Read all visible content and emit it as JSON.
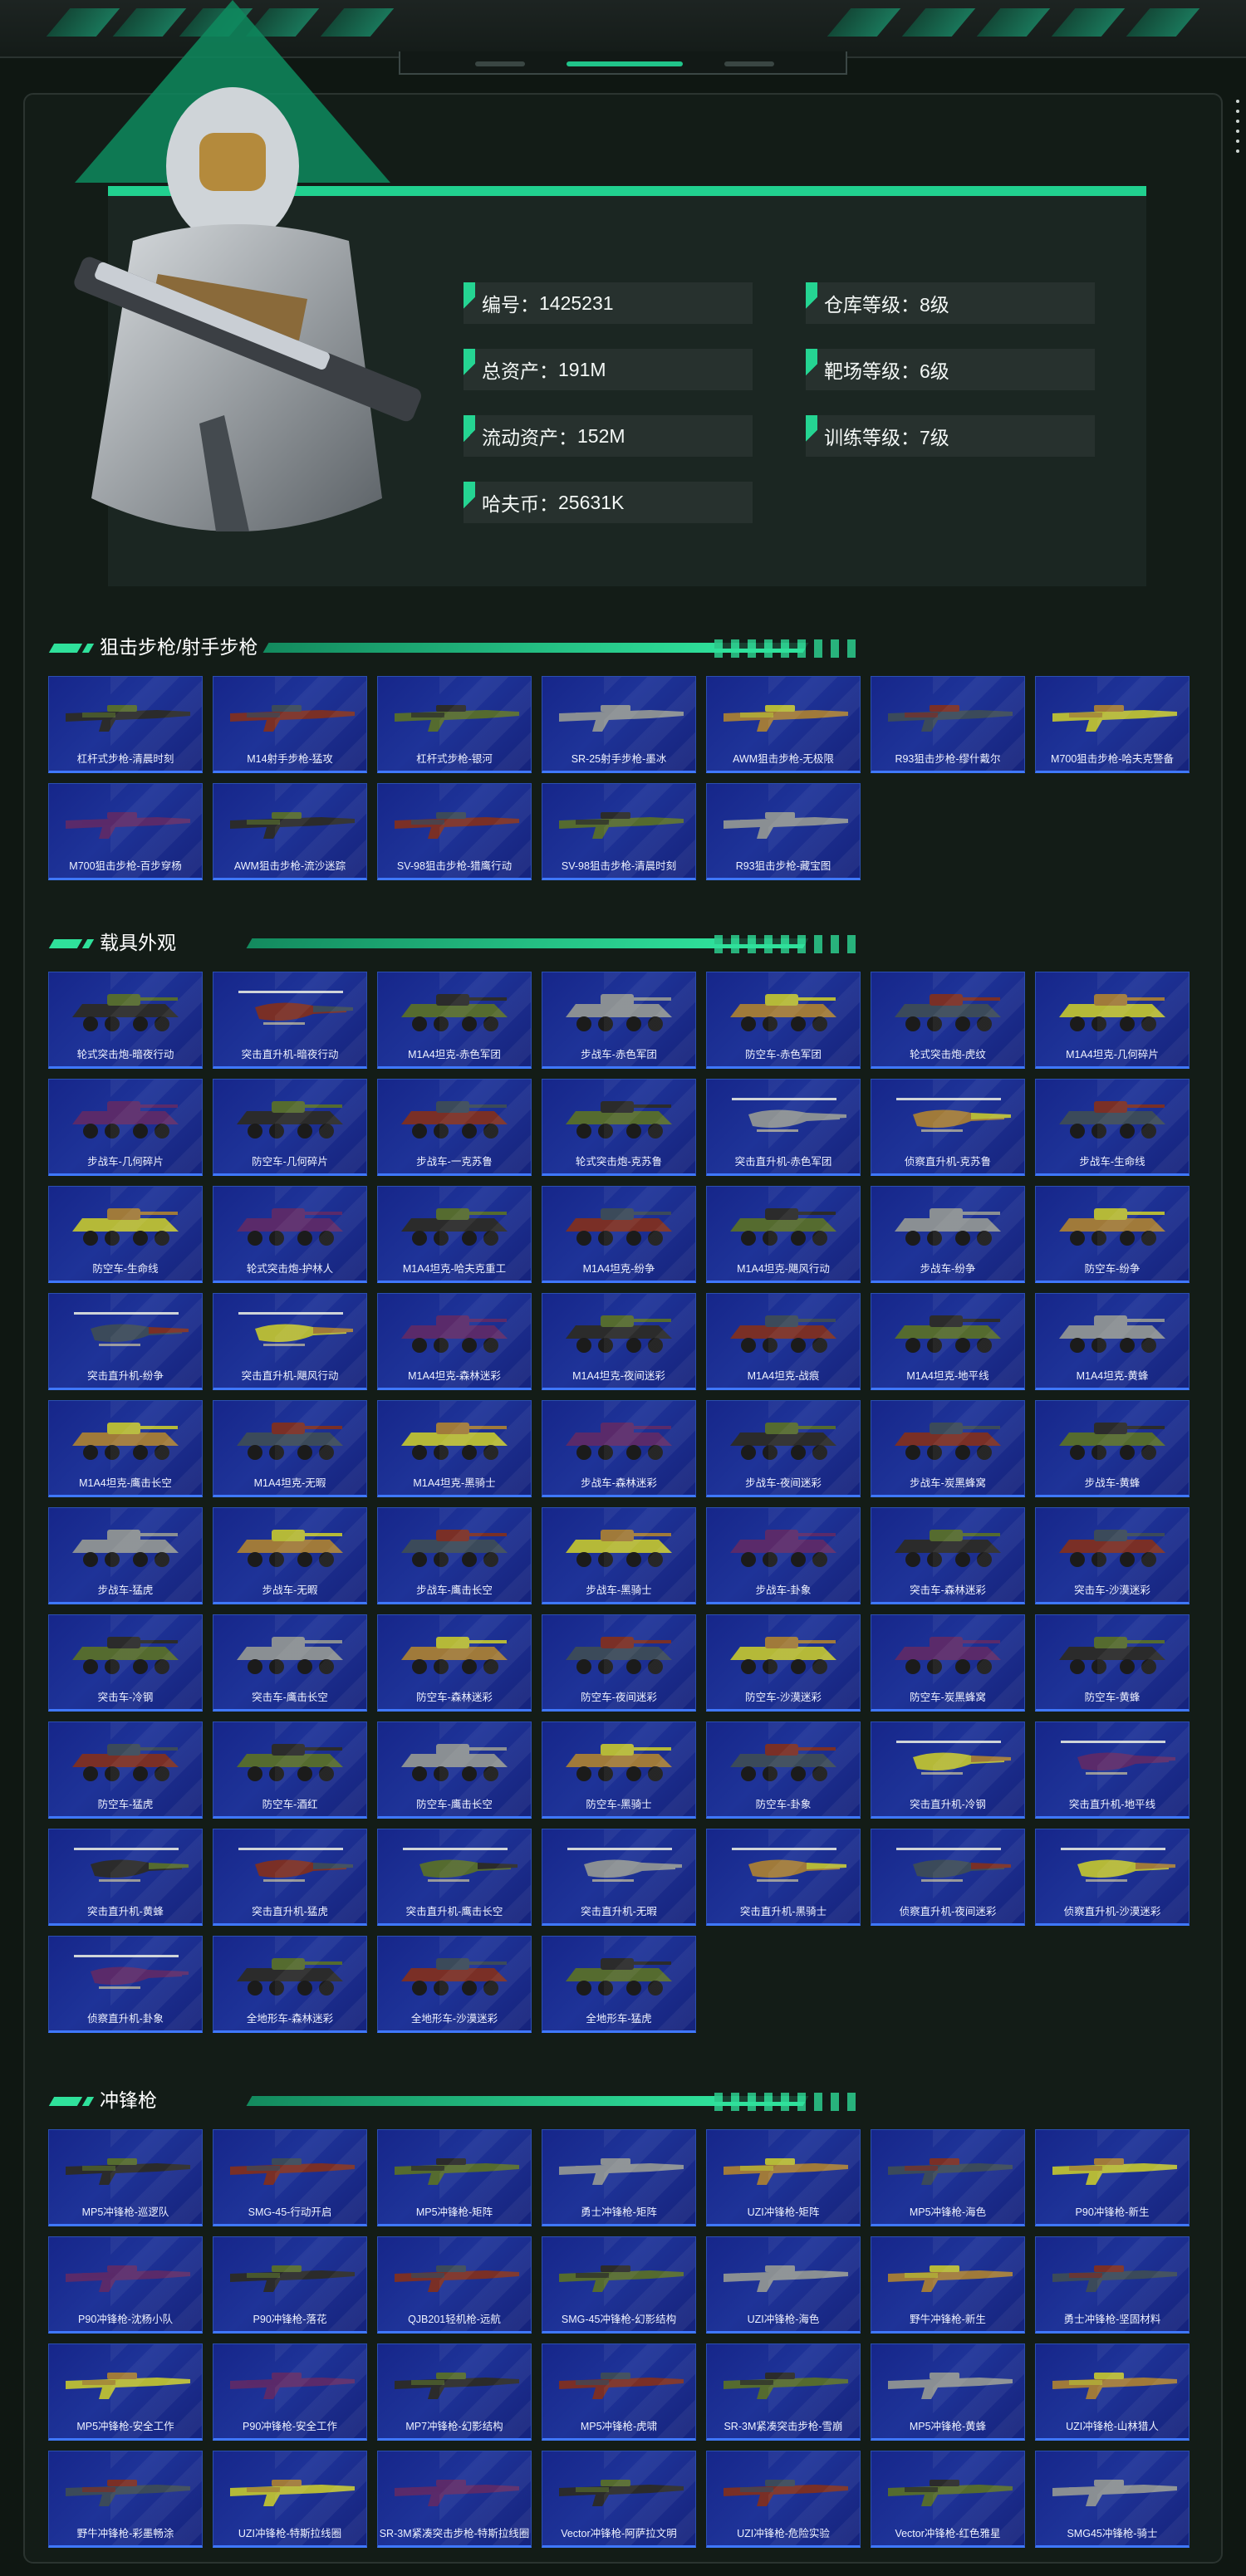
{
  "profile": {
    "stats": [
      {
        "label": "编号：",
        "value": "1425231"
      },
      {
        "label": "仓库等级：",
        "value": "8级"
      },
      {
        "label": "总资产：",
        "value": "191M"
      },
      {
        "label": "靶场等级：",
        "value": "6级"
      },
      {
        "label": "流动资产：",
        "value": "152M"
      },
      {
        "label": "训练等级：",
        "value": "7级"
      },
      {
        "label": "哈夫币：",
        "value": "25631K"
      }
    ]
  },
  "sections": [
    {
      "title": "狙击步枪/射手步枪",
      "kind": "gun",
      "items": [
        "杠杆式步枪-清晨时刻",
        "M14射手步枪-猛攻",
        "杠杆式步枪-银河",
        "SR-25射手步枪-墨冰",
        "AWM狙击步枪-无极限",
        "R93狙击步枪-缪什戴尔",
        "M700狙击步枪-哈夫克警备",
        "M700狙击步枪-百步穿杨",
        "AWM狙击步枪-流沙迷踪",
        "SV-98狙击步枪-猎鹰行动",
        "SV-98狙击步枪-清晨时刻",
        "R93狙击步枪-藏宝图"
      ]
    },
    {
      "title": "载具外观",
      "kind": "vehicle",
      "items": [
        "轮式突击炮-暗夜行动",
        "突击直升机-暗夜行动",
        "M1A4坦克-赤色军团",
        "步战车-赤色军团",
        "防空车-赤色军团",
        "轮式突击炮-虎纹",
        "M1A4坦克-几何碎片",
        "步战车-几何碎片",
        "防空车-几何碎片",
        "步战车-一克苏鲁",
        "轮式突击炮-克苏鲁",
        "突击直升机-赤色军团",
        "侦察直升机-克苏鲁",
        "步战车-生命线",
        "防空车-生命线",
        "轮式突击炮-护林人",
        "M1A4坦克-哈夫克重工",
        "M1A4坦克-纷争",
        "M1A4坦克-飓风行动",
        "步战车-纷争",
        "防空车-纷争",
        "突击直升机-纷争",
        "突击直升机-飓风行动",
        "M1A4坦克-森林迷彩",
        "M1A4坦克-夜间迷彩",
        "M1A4坦克-战痕",
        "M1A4坦克-地平线",
        "M1A4坦克-黄蜂",
        "M1A4坦克-鹰击长空",
        "M1A4坦克-无暇",
        "M1A4坦克-黑骑士",
        "步战车-森林迷彩",
        "步战车-夜间迷彩",
        "步战车-炭黑蜂窝",
        "步战车-黄蜂",
        "步战车-猛虎",
        "步战车-无暇",
        "步战车-鹰击长空",
        "步战车-黑骑士",
        "步战车-卦象",
        "突击车-森林迷彩",
        "突击车-沙漠迷彩",
        "突击车-冷钢",
        "突击车-鹰击长空",
        "防空车-森林迷彩",
        "防空车-夜间迷彩",
        "防空车-沙漠迷彩",
        "防空车-炭黑蜂窝",
        "防空车-黄蜂",
        "防空车-猛虎",
        "防空车-酒红",
        "防空车-鹰击长空",
        "防空车-黑骑士",
        "防空车-卦象",
        "突击直升机-冷钢",
        "突击直升机-地平线",
        "突击直升机-黄蜂",
        "突击直升机-猛虎",
        "突击直升机-鹰击长空",
        "突击直升机-无暇",
        "突击直升机-黑骑士",
        "侦察直升机-夜间迷彩",
        "侦察直升机-沙漠迷彩",
        "侦察直升机-卦象",
        "全地形车-森林迷彩",
        "全地形车-沙漠迷彩",
        "全地形车-猛虎"
      ]
    },
    {
      "title": "冲锋枪",
      "kind": "smg",
      "items": [
        "MP5冲锋枪-巡逻队",
        "SMG-45-行动开启",
        "MP5冲锋枪-矩阵",
        "勇士冲锋枪-矩阵",
        "UZI冲锋枪-矩阵",
        "MP5冲锋枪-海色",
        "P90冲锋枪-新生",
        "P90冲锋枪-沈杨小队",
        "P90冲锋枪-落花",
        "QJB201轻机枪-远航",
        "SMG-45冲锋枪-幻影结构",
        "UZI冲锋枪-海色",
        "野牛冲锋枪-新生",
        "勇士冲锋枪-坚固材料",
        "MP5冲锋枪-安全工作",
        "P90冲锋枪-安全工作",
        "MP7冲锋枪-幻影结构",
        "MP5冲锋枪-虎啸",
        "SR-3M紧凑突击步枪-雪崩",
        "MP5冲锋枪-黄蜂",
        "UZI冲锋枪-山林猎人",
        "野牛冲锋枪-彩墨畅涂",
        "UZI冲锋枪-特斯拉线圈",
        "SR-3M紧凑突击步枪-特斯拉线圈",
        "Vector冲锋枪-阿萨拉文明",
        "UZI冲锋枪-危险实验",
        "Vector冲锋枪-红色雅星",
        "SMG45冲锋枪-骑士"
      ]
    }
  ],
  "colors": {
    "accent": "#2fe19b",
    "card_bg": "#1a2a8c",
    "card_border": "#3f78ff"
  }
}
